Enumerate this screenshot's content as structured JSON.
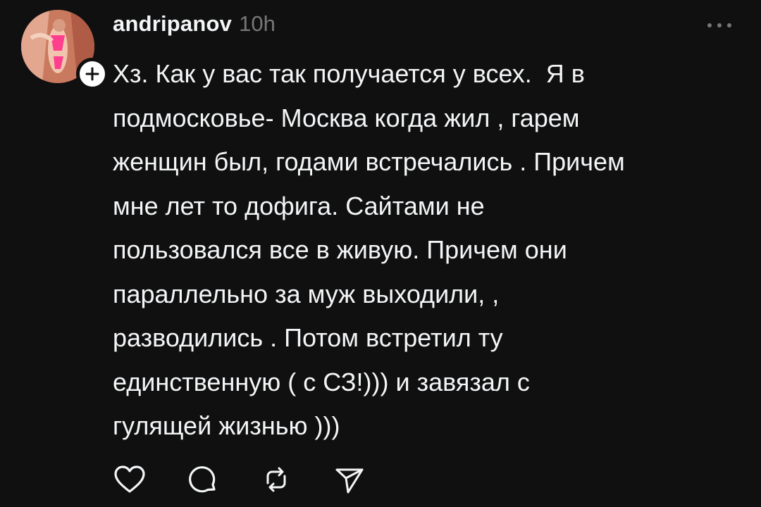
{
  "post": {
    "username": "andripanov",
    "timestamp": "10h",
    "text": "Хз. Как у вас так получается у всех.  Я в\nподмосковье- Москва когда жил , гарем\nженщин был, годами встречались . Причем\nмне лет то дофига. Сайтами не\nпользовался все в живую. Причем они\nпараллельно за муж выходили, ,\nразводились . Потом встретил ту\nединственную ( с СЗ!))) и завязал с\nгулящей жизнью )))"
  },
  "icons": {
    "more": "more-horizontal-icon",
    "follow": "plus-icon",
    "like": "heart-icon",
    "comment": "comment-icon",
    "repost": "repost-icon",
    "share": "send-icon"
  },
  "colors": {
    "background": "#101010",
    "text": "#f3f5f7",
    "muted": "#777777"
  }
}
